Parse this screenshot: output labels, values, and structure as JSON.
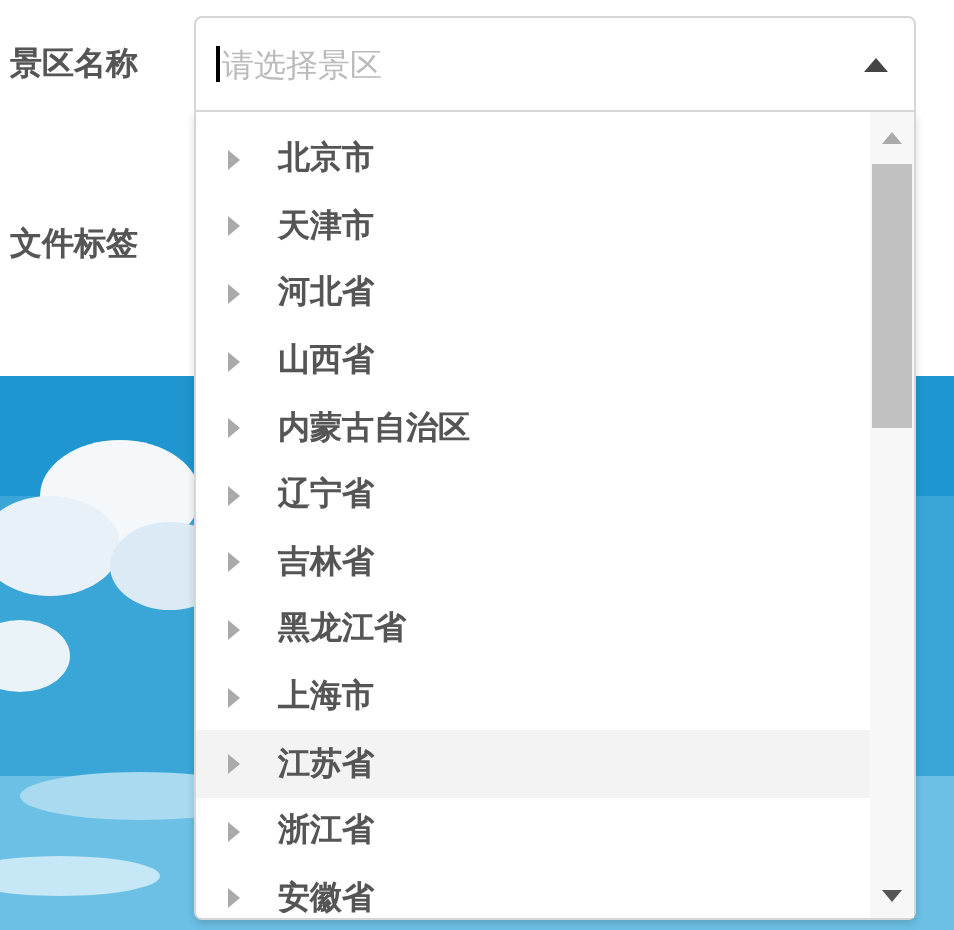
{
  "form": {
    "labels": [
      "景区名称",
      "文件标签"
    ]
  },
  "select": {
    "placeholder": "请选择景区",
    "expanded": true,
    "options": [
      {
        "label": "北京市",
        "selected": false
      },
      {
        "label": "天津市",
        "selected": false
      },
      {
        "label": "河北省",
        "selected": false
      },
      {
        "label": "山西省",
        "selected": false
      },
      {
        "label": "内蒙古自治区",
        "selected": false
      },
      {
        "label": "辽宁省",
        "selected": false
      },
      {
        "label": "吉林省",
        "selected": false
      },
      {
        "label": "黑龙江省",
        "selected": false
      },
      {
        "label": "上海市",
        "selected": false
      },
      {
        "label": "江苏省",
        "selected": true
      },
      {
        "label": "浙江省",
        "selected": false
      },
      {
        "label": "安徽省",
        "selected": false
      }
    ]
  }
}
